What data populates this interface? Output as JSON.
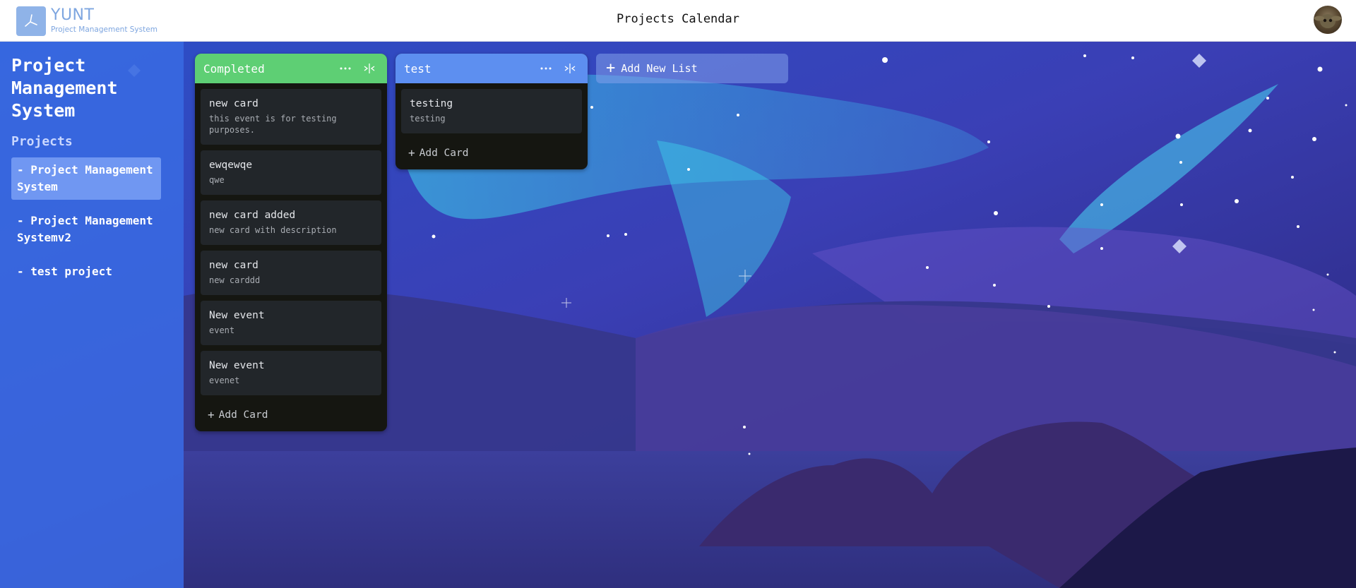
{
  "app": {
    "logo_name": "YUNT",
    "logo_sub": "Project Management System",
    "page_title": "Projects Calendar"
  },
  "sidebar": {
    "title": "Project Management System",
    "section": "Projects",
    "projects": [
      {
        "label": "- Project Management System",
        "active": true
      },
      {
        "label": "- Project Management Systemv2",
        "active": false
      },
      {
        "label": "- test project",
        "active": false
      }
    ]
  },
  "board": {
    "lists": [
      {
        "title": "Completed",
        "color": "#5ecf74",
        "cards": [
          {
            "title": "new card",
            "desc": "this event is for testing purposes."
          },
          {
            "title": "ewqewqe",
            "desc": "qwe"
          },
          {
            "title": "new card added",
            "desc": "new card with description"
          },
          {
            "title": "new card",
            "desc": "new carddd"
          },
          {
            "title": "New event",
            "desc": "event"
          },
          {
            "title": "New event",
            "desc": "evenet"
          }
        ],
        "add_card_label": "Add Card"
      },
      {
        "title": "test",
        "color": "#5d8ff0",
        "cards": [
          {
            "title": "testing",
            "desc": "testing"
          }
        ],
        "add_card_label": "Add Card"
      }
    ],
    "add_list_label": "Add New List"
  },
  "icons": {
    "more": "more-horizontal-icon",
    "collapse": "collapse-horizontal-icon",
    "plus": "plus-icon"
  }
}
